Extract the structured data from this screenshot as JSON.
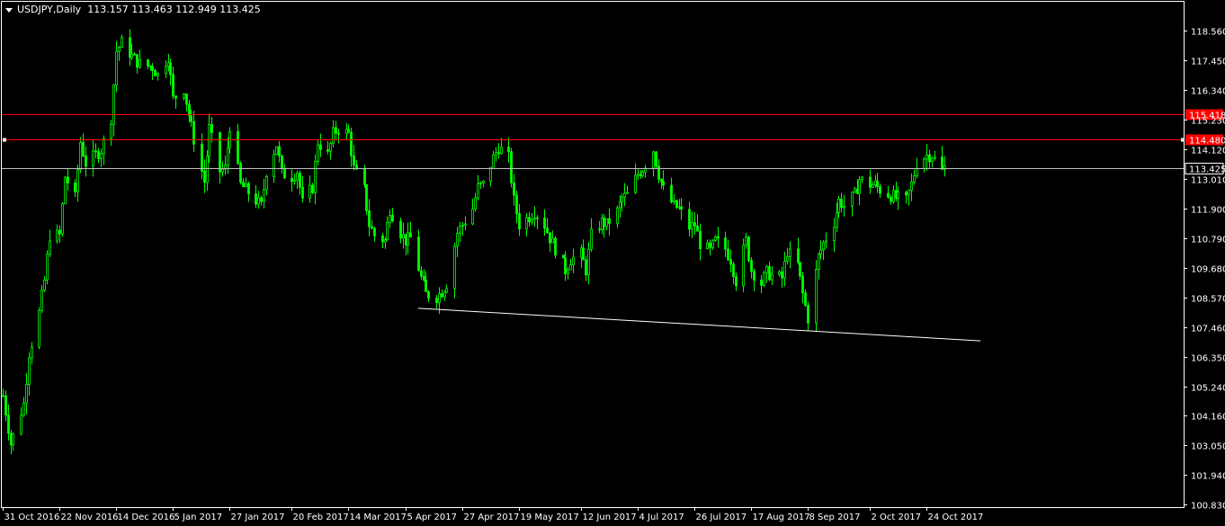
{
  "window": {
    "symbol_label": "USDJPY,Daily",
    "ohlc": [
      "113.157",
      "113.463",
      "112.949",
      "113.425"
    ],
    "collapse_icon": "triangle-down-icon"
  },
  "colors": {
    "background": "#000000",
    "bull_candle": "#00ff00",
    "hline": "#ff0000",
    "price_line": "#c0c0c0",
    "trendline": "#ffffff"
  },
  "chart_data": {
    "type": "candlestick",
    "title": "USDJPY,Daily",
    "y_ticks": [
      "118.560",
      "117.450",
      "116.340",
      "115.230",
      "114.120",
      "113.010",
      "111.900",
      "110.790",
      "109.680",
      "108.570",
      "107.460",
      "106.350",
      "105.240",
      "104.160",
      "103.050",
      "101.940",
      "100.830"
    ],
    "x_ticks": [
      "31 Oct 2016",
      "22 Nov 2016",
      "14 Dec 2016",
      "5 Jan 2017",
      "27 Jan 2017",
      "20 Feb 2017",
      "14 Mar 2017",
      "5 Apr 2017",
      "27 Apr 2017",
      "19 May 2017",
      "12 Jun 2017",
      "4 Jul 2017",
      "26 Jul 2017",
      "17 Aug 2017",
      "8 Sep 2017",
      "2 Oct 2017",
      "24 Oct 2017"
    ],
    "ylim": [
      100.83,
      119.0
    ],
    "horizontal_lines": [
      {
        "price": 115.418,
        "label": "115.418"
      },
      {
        "price": 114.48,
        "label": "114.480"
      }
    ],
    "current_price": {
      "price": 113.425,
      "label": "113.425"
    },
    "trendline": {
      "from": {
        "date": "10 Apr 2017",
        "price": 108.17
      },
      "to": {
        "date": "14 Nov 2017",
        "price": 106.95
      }
    },
    "close_path": [
      [
        "31 Oct 2016",
        104.9
      ],
      [
        "3 Nov 2016",
        103.1
      ],
      [
        "8 Nov 2016",
        104.6
      ],
      [
        "10 Nov 2016",
        106.5
      ],
      [
        "14 Nov 2016",
        108.0
      ],
      [
        "16 Nov 2016",
        109.2
      ],
      [
        "18 Nov 2016",
        110.9
      ],
      [
        "22 Nov 2016",
        110.9
      ],
      [
        "24 Nov 2016",
        113.1
      ],
      [
        "28 Nov 2016",
        112.3
      ],
      [
        "30 Nov 2016",
        114.4
      ],
      [
        "2 Dec 2016",
        113.6
      ],
      [
        "6 Dec 2016",
        113.9
      ],
      [
        "8 Dec 2016",
        114.1
      ],
      [
        "12 Dec 2016",
        115.3
      ],
      [
        "14 Dec 2016",
        117.8
      ],
      [
        "16 Dec 2016",
        118.1
      ],
      [
        "20 Dec 2016",
        117.6
      ],
      [
        "23 Dec 2016",
        117.3
      ],
      [
        "28 Dec 2016",
        117.2
      ],
      [
        "30 Dec 2016",
        116.9
      ],
      [
        "3 Jan 2017",
        117.6
      ],
      [
        "5 Jan 2017",
        116.0
      ],
      [
        "9 Jan 2017",
        116.4
      ],
      [
        "11 Jan 2017",
        115.4
      ],
      [
        "13 Jan 2017",
        114.5
      ],
      [
        "17 Jan 2017",
        112.9
      ],
      [
        "19 Jan 2017",
        114.9
      ],
      [
        "23 Jan 2017",
        113.3
      ],
      [
        "25 Jan 2017",
        113.4
      ],
      [
        "27 Jan 2017",
        115.0
      ],
      [
        "31 Jan 2017",
        112.8
      ],
      [
        "2 Feb 2017",
        112.6
      ],
      [
        "6 Feb 2017",
        112.2
      ],
      [
        "8 Feb 2017",
        112.0
      ],
      [
        "10 Feb 2017",
        113.3
      ],
      [
        "14 Feb 2017",
        114.3
      ],
      [
        "16 Feb 2017",
        113.2
      ],
      [
        "20 Feb 2017",
        113.1
      ],
      [
        "22 Feb 2017",
        113.3
      ],
      [
        "24 Feb 2017",
        112.1
      ],
      [
        "28 Feb 2017",
        112.7
      ],
      [
        "2 Mar 2017",
        114.4
      ],
      [
        "6 Mar 2017",
        113.9
      ],
      [
        "8 Mar 2017",
        114.7
      ],
      [
        "10 Mar 2017",
        114.9
      ],
      [
        "14 Mar 2017",
        114.7
      ],
      [
        "16 Mar 2017",
        113.4
      ],
      [
        "20 Mar 2017",
        112.6
      ],
      [
        "22 Mar 2017",
        111.3
      ],
      [
        "24 Mar 2017",
        110.9
      ],
      [
        "28 Mar 2017",
        110.7
      ],
      [
        "30 Mar 2017",
        111.9
      ],
      [
        "3 Apr 2017",
        111.0
      ],
      [
        "5 Apr 2017",
        110.7
      ],
      [
        "7 Apr 2017",
        110.8
      ],
      [
        "11 Apr 2017",
        109.3
      ],
      [
        "13 Apr 2017",
        108.7
      ],
      [
        "17 Apr 2017",
        108.6
      ],
      [
        "19 Apr 2017",
        108.8
      ],
      [
        "21 Apr 2017",
        109.1
      ],
      [
        "25 Apr 2017",
        111.0
      ],
      [
        "27 Apr 2017",
        111.3
      ],
      [
        "1 May 2017",
        111.9
      ],
      [
        "3 May 2017",
        112.7
      ],
      [
        "5 May 2017",
        112.8
      ],
      [
        "9 May 2017",
        113.8
      ],
      [
        "11 May 2017",
        114.2
      ],
      [
        "15 May 2017",
        113.8
      ],
      [
        "17 May 2017",
        112.2
      ],
      [
        "19 May 2017",
        111.3
      ],
      [
        "23 May 2017",
        111.6
      ],
      [
        "25 May 2017",
        111.8
      ],
      [
        "29 May 2017",
        111.3
      ],
      [
        "31 May 2017",
        110.8
      ],
      [
        "2 Jun 2017",
        110.4
      ],
      [
        "6 Jun 2017",
        109.6
      ],
      [
        "8 Jun 2017",
        110.0
      ],
      [
        "12 Jun 2017",
        110.2
      ],
      [
        "14 Jun 2017",
        109.6
      ],
      [
        "16 Jun 2017",
        110.9
      ],
      [
        "20 Jun 2017",
        111.4
      ],
      [
        "22 Jun 2017",
        111.3
      ],
      [
        "26 Jun 2017",
        111.8
      ],
      [
        "28 Jun 2017",
        112.3
      ],
      [
        "30 Jun 2017",
        112.4
      ],
      [
        "4 Jul 2017",
        113.2
      ],
      [
        "6 Jul 2017",
        113.4
      ],
      [
        "10 Jul 2017",
        114.1
      ],
      [
        "12 Jul 2017",
        113.2
      ],
      [
        "14 Jul 2017",
        112.6
      ],
      [
        "18 Jul 2017",
        112.0
      ],
      [
        "20 Jul 2017",
        111.9
      ],
      [
        "24 Jul 2017",
        111.2
      ],
      [
        "26 Jul 2017",
        111.3
      ],
      [
        "28 Jul 2017",
        110.6
      ],
      [
        "1 Aug 2017",
        110.3
      ],
      [
        "3 Aug 2017",
        110.7
      ],
      [
        "7 Aug 2017",
        110.4
      ],
      [
        "9 Aug 2017",
        110.0
      ],
      [
        "11 Aug 2017",
        109.2
      ],
      [
        "15 Aug 2017",
        110.7
      ],
      [
        "17 Aug 2017",
        109.6
      ],
      [
        "21 Aug 2017",
        109.1
      ],
      [
        "23 Aug 2017",
        109.5
      ],
      [
        "25 Aug 2017",
        109.4
      ],
      [
        "29 Aug 2017",
        109.3
      ],
      [
        "31 Aug 2017",
        110.3
      ],
      [
        "4 Sep 2017",
        109.8
      ],
      [
        "6 Sep 2017",
        108.7
      ],
      [
        "8 Sep 2017",
        107.8
      ],
      [
        "12 Sep 2017",
        110.1
      ],
      [
        "14 Sep 2017",
        110.6
      ],
      [
        "18 Sep 2017",
        111.4
      ],
      [
        "20 Sep 2017",
        112.2
      ],
      [
        "22 Sep 2017",
        112.0
      ],
      [
        "26 Sep 2017",
        112.4
      ],
      [
        "28 Sep 2017",
        113.0
      ],
      [
        "2 Oct 2017",
        112.8
      ],
      [
        "4 Oct 2017",
        112.8
      ],
      [
        "6 Oct 2017",
        112.6
      ],
      [
        "10 Oct 2017",
        112.4
      ],
      [
        "12 Oct 2017",
        112.3
      ],
      [
        "16 Oct 2017",
        112.2
      ],
      [
        "18 Oct 2017",
        112.8
      ],
      [
        "20 Oct 2017",
        113.6
      ],
      [
        "24 Oct 2017",
        113.9
      ],
      [
        "26 Oct 2017",
        113.9
      ],
      [
        "30 Oct 2017",
        113.3
      ],
      [
        "31 Oct 2017",
        113.425
      ]
    ]
  }
}
